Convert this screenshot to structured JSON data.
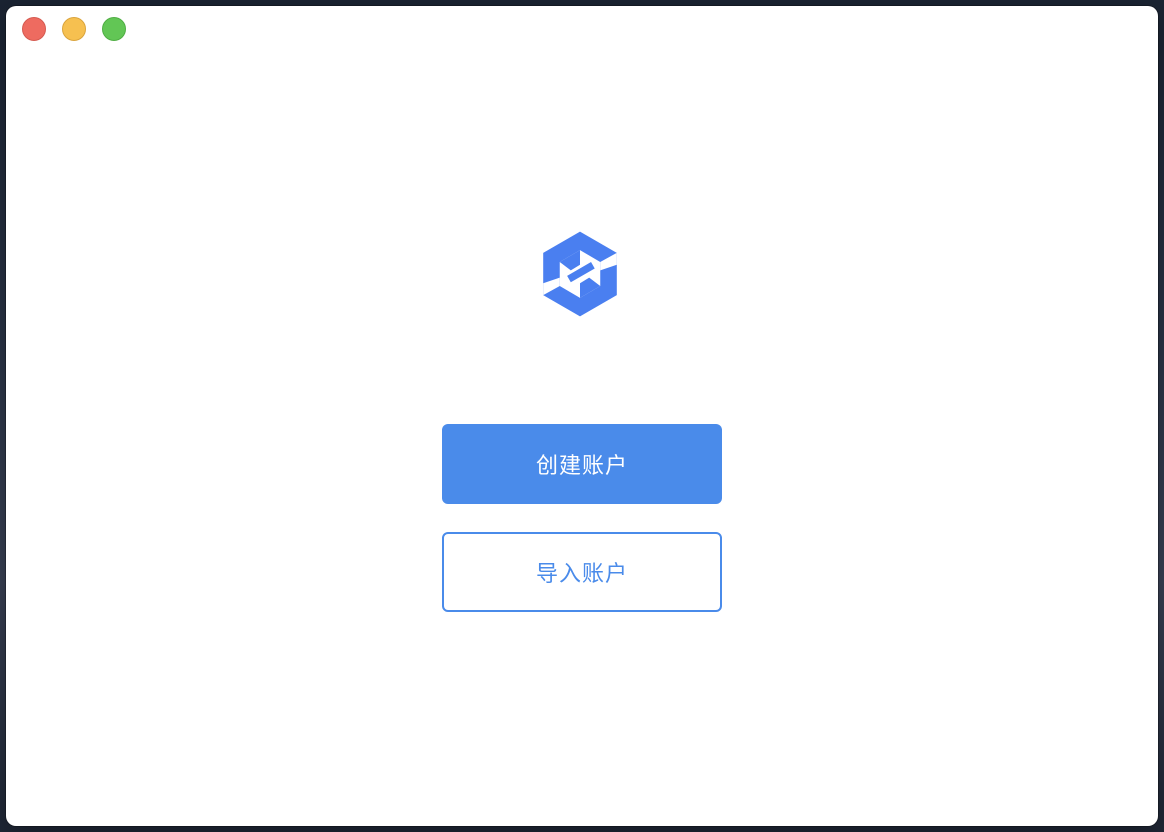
{
  "window": {
    "controls": {
      "close": "close",
      "minimize": "minimize",
      "maximize": "maximize"
    }
  },
  "logo": {
    "icon": "hexagon-s-logo",
    "color": "#4a7ff0"
  },
  "actions": {
    "create_label": "创建账户",
    "import_label": "导入账户"
  },
  "colors": {
    "accent": "#4a8bea",
    "close": "#ee6b60",
    "minimize": "#f6c050",
    "maximize": "#62c655"
  }
}
